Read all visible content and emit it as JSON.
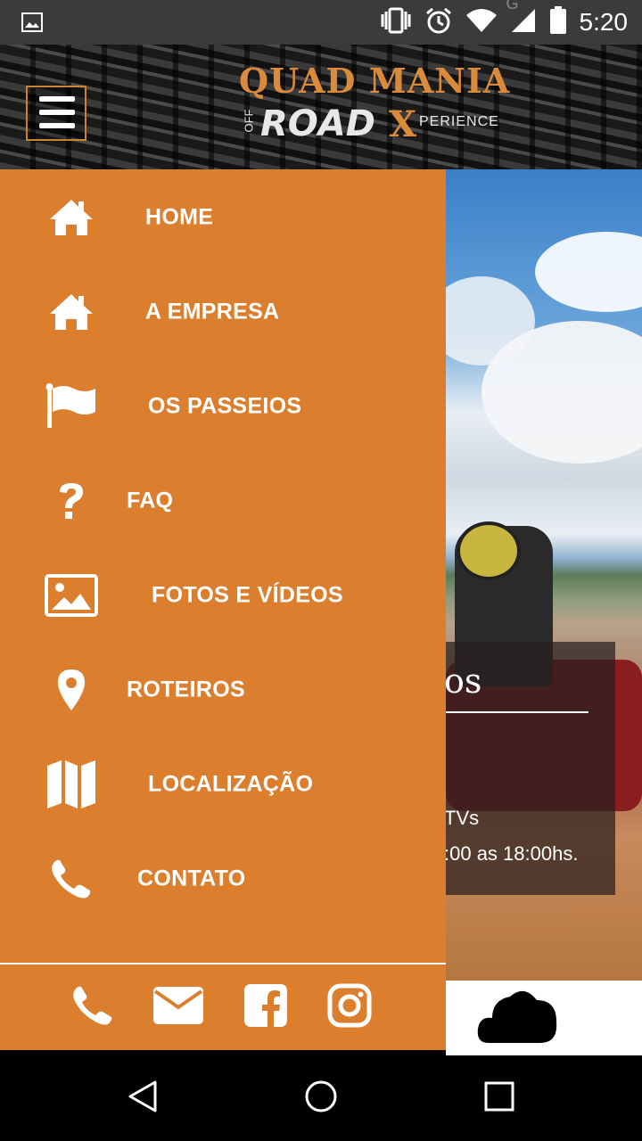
{
  "status_bar": {
    "time": "5:20",
    "network_letter": "G",
    "icons": [
      "image-notification-icon",
      "vibrate-icon",
      "alarm-icon",
      "wifi-icon",
      "signal-icon",
      "battery-icon"
    ]
  },
  "header": {
    "logo_line1": "QUAD MANIA",
    "logo_off": "OFF",
    "logo_road": "ROAD",
    "logo_x": "X",
    "logo_perience": "PERIENCE",
    "menu_icon": "hamburger-icon"
  },
  "drawer": {
    "background": "#db7f2f",
    "items": [
      {
        "label": "HOME",
        "icon": "home-icon"
      },
      {
        "label": "A EMPRESA",
        "icon": "home-icon"
      },
      {
        "label": "OS PASSEIOS",
        "icon": "flag-icon"
      },
      {
        "label": "FAQ",
        "icon": "question-icon"
      },
      {
        "label": "FOTOS E VÍDEOS",
        "icon": "image-icon"
      },
      {
        "label": "ROTEIROS",
        "icon": "map-pin-icon"
      },
      {
        "label": "LOCALIZAÇÃO",
        "icon": "map-icon"
      },
      {
        "label": "CONTATO",
        "icon": "phone-icon"
      }
    ],
    "social": [
      "phone-icon",
      "email-icon",
      "facebook-icon",
      "instagram-icon"
    ]
  },
  "background_content": {
    "title_fragment": "os",
    "line1_fragment": "TVs",
    "line2_fragment": ":00 as 18:00hs.",
    "weather_icon": "cloud-icon"
  },
  "nav_bar": {
    "buttons": [
      "back-icon",
      "home-circle-icon",
      "recents-icon"
    ]
  }
}
